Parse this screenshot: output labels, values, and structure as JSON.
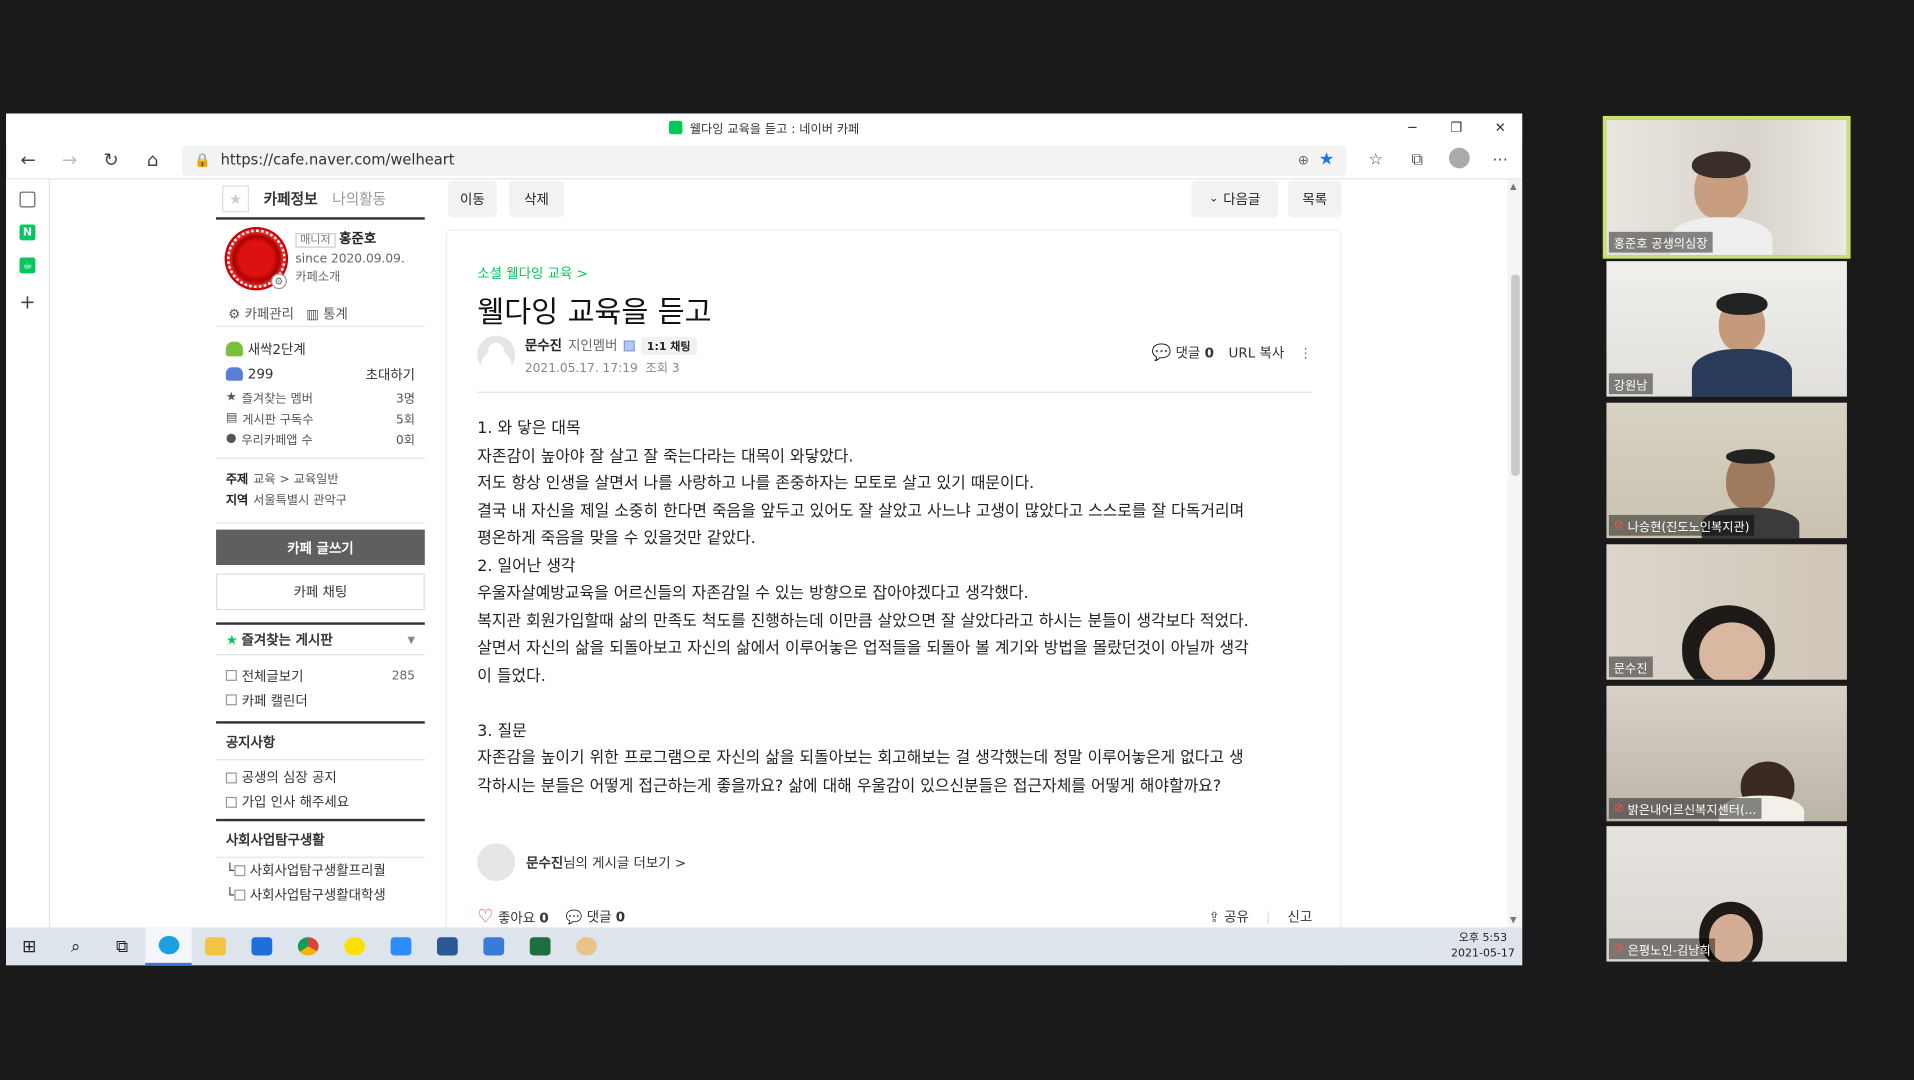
{
  "browser": {
    "window_title": "웰다잉 교육을 듣고 : 네이버 카페",
    "url": "https://cafe.naver.com/welheart"
  },
  "cafe_sidebar": {
    "tabs": [
      "카페정보",
      "나의활동"
    ],
    "manager_badge": "매니저",
    "manager_name": "홍준호",
    "since": "since 2020.09.09.",
    "intro_link": "카페소개",
    "manage_link": "카페관리",
    "stats_link": "통계",
    "level": "새싹2단계",
    "members": "299",
    "invite": "초대하기",
    "stat_rows": [
      {
        "label": "즐겨찾는 멤버",
        "value": "3명"
      },
      {
        "label": "게시판 구독수",
        "value": "5회"
      },
      {
        "label": "우리카페앱 수",
        "value": "0회"
      }
    ],
    "topic_label": "주제",
    "topic_value": "교육 > 교육일반",
    "region_label": "지역",
    "region_value": "서울특별시 관악구",
    "write_button": "카페 글쓰기",
    "chat_button": "카페 채팅",
    "fav_boards": "즐겨찾는 게시판",
    "all_posts": "전체글보기",
    "all_posts_count": "285",
    "calendar": "카페 캘린더",
    "notice_head": "공지사항",
    "notice_items": [
      "공생의 심장 공지",
      "가입 인사 해주세요"
    ],
    "social_head": "사회사업탐구생활",
    "social_items": [
      "사회사업탐구생활프리퀄",
      "사회사업탐구생활대학생"
    ]
  },
  "toolbar": {
    "move": "이동",
    "delete": "삭제",
    "next": "다음글",
    "list": "목록"
  },
  "article": {
    "breadcrumb": "소셜 웰다잉 교육 >",
    "title": "웰다잉 교육을 듣고",
    "author": "문수진",
    "grade": "지인멤버",
    "chat": "1:1 채팅",
    "date": "2021.05.17. 17:19",
    "views": "조회 3",
    "comments_label": "댓글",
    "comments_count": "0",
    "url_copy": "URL 복사",
    "lines": [
      "1. 와 닿은 대목",
      "자존감이 높아야 잘 살고 잘 죽는다라는 대목이 와닿았다.",
      "저도 항상 인생을 살면서 나를 사랑하고 나를 존중하자는 모토로 살고 있기 때문이다.",
      "결국 내 자신을 제일 소중히 한다면 죽음을 앞두고 있어도 잘 살았고 사느냐 고생이 많았다고 스스로를 잘 다독거리며",
      "평온하게 죽음을 맞을 수 있을것만 같았다.",
      "2. 일어난 생각",
      "우울자살예방교육을 어르신들의 자존감일 수 있는 방향으로 잡아야겠다고 생각했다.",
      "복지관 회원가입할때 삶의 만족도 척도를 진행하는데 이만큼 살았으면 잘 살았다라고 하시는 분들이 생각보다 적었다.",
      "살면서 자신의 삶을 되돌아보고 자신의 삶에서 이루어놓은 업적들을 되돌아 볼 계기와  방법을 몰랐던것이 아닐까 생각",
      "이 들었다.",
      "",
      "3. 질문",
      "자존감을 높이기 위한 프로그램으로 자신의 삶을 되돌아보는 회고해보는 걸 생각했는데 정말 이루어놓은게 없다고 생",
      "각하시는 분들은 어떻게 접근하는게 좋을까요? 삶에 대해 우울감이 있으신분들은 접근자체를 어떻게 해야할까요?"
    ],
    "more_posts_suffix": "님의 게시글 더보기 >",
    "like_label": "좋아요",
    "like_count": "0",
    "comment_label": "댓글",
    "comment_count": "0",
    "share": "공유",
    "report": "신고"
  },
  "taskbar": {
    "time": "오후 5:53",
    "date": "2021-05-17"
  },
  "participants": [
    "홍준호 공생의심장",
    "강원남",
    "나승현(진도노인복지관)",
    "문수진",
    "밝은내어르신복지센터(...",
    "은평노인-김남희"
  ]
}
